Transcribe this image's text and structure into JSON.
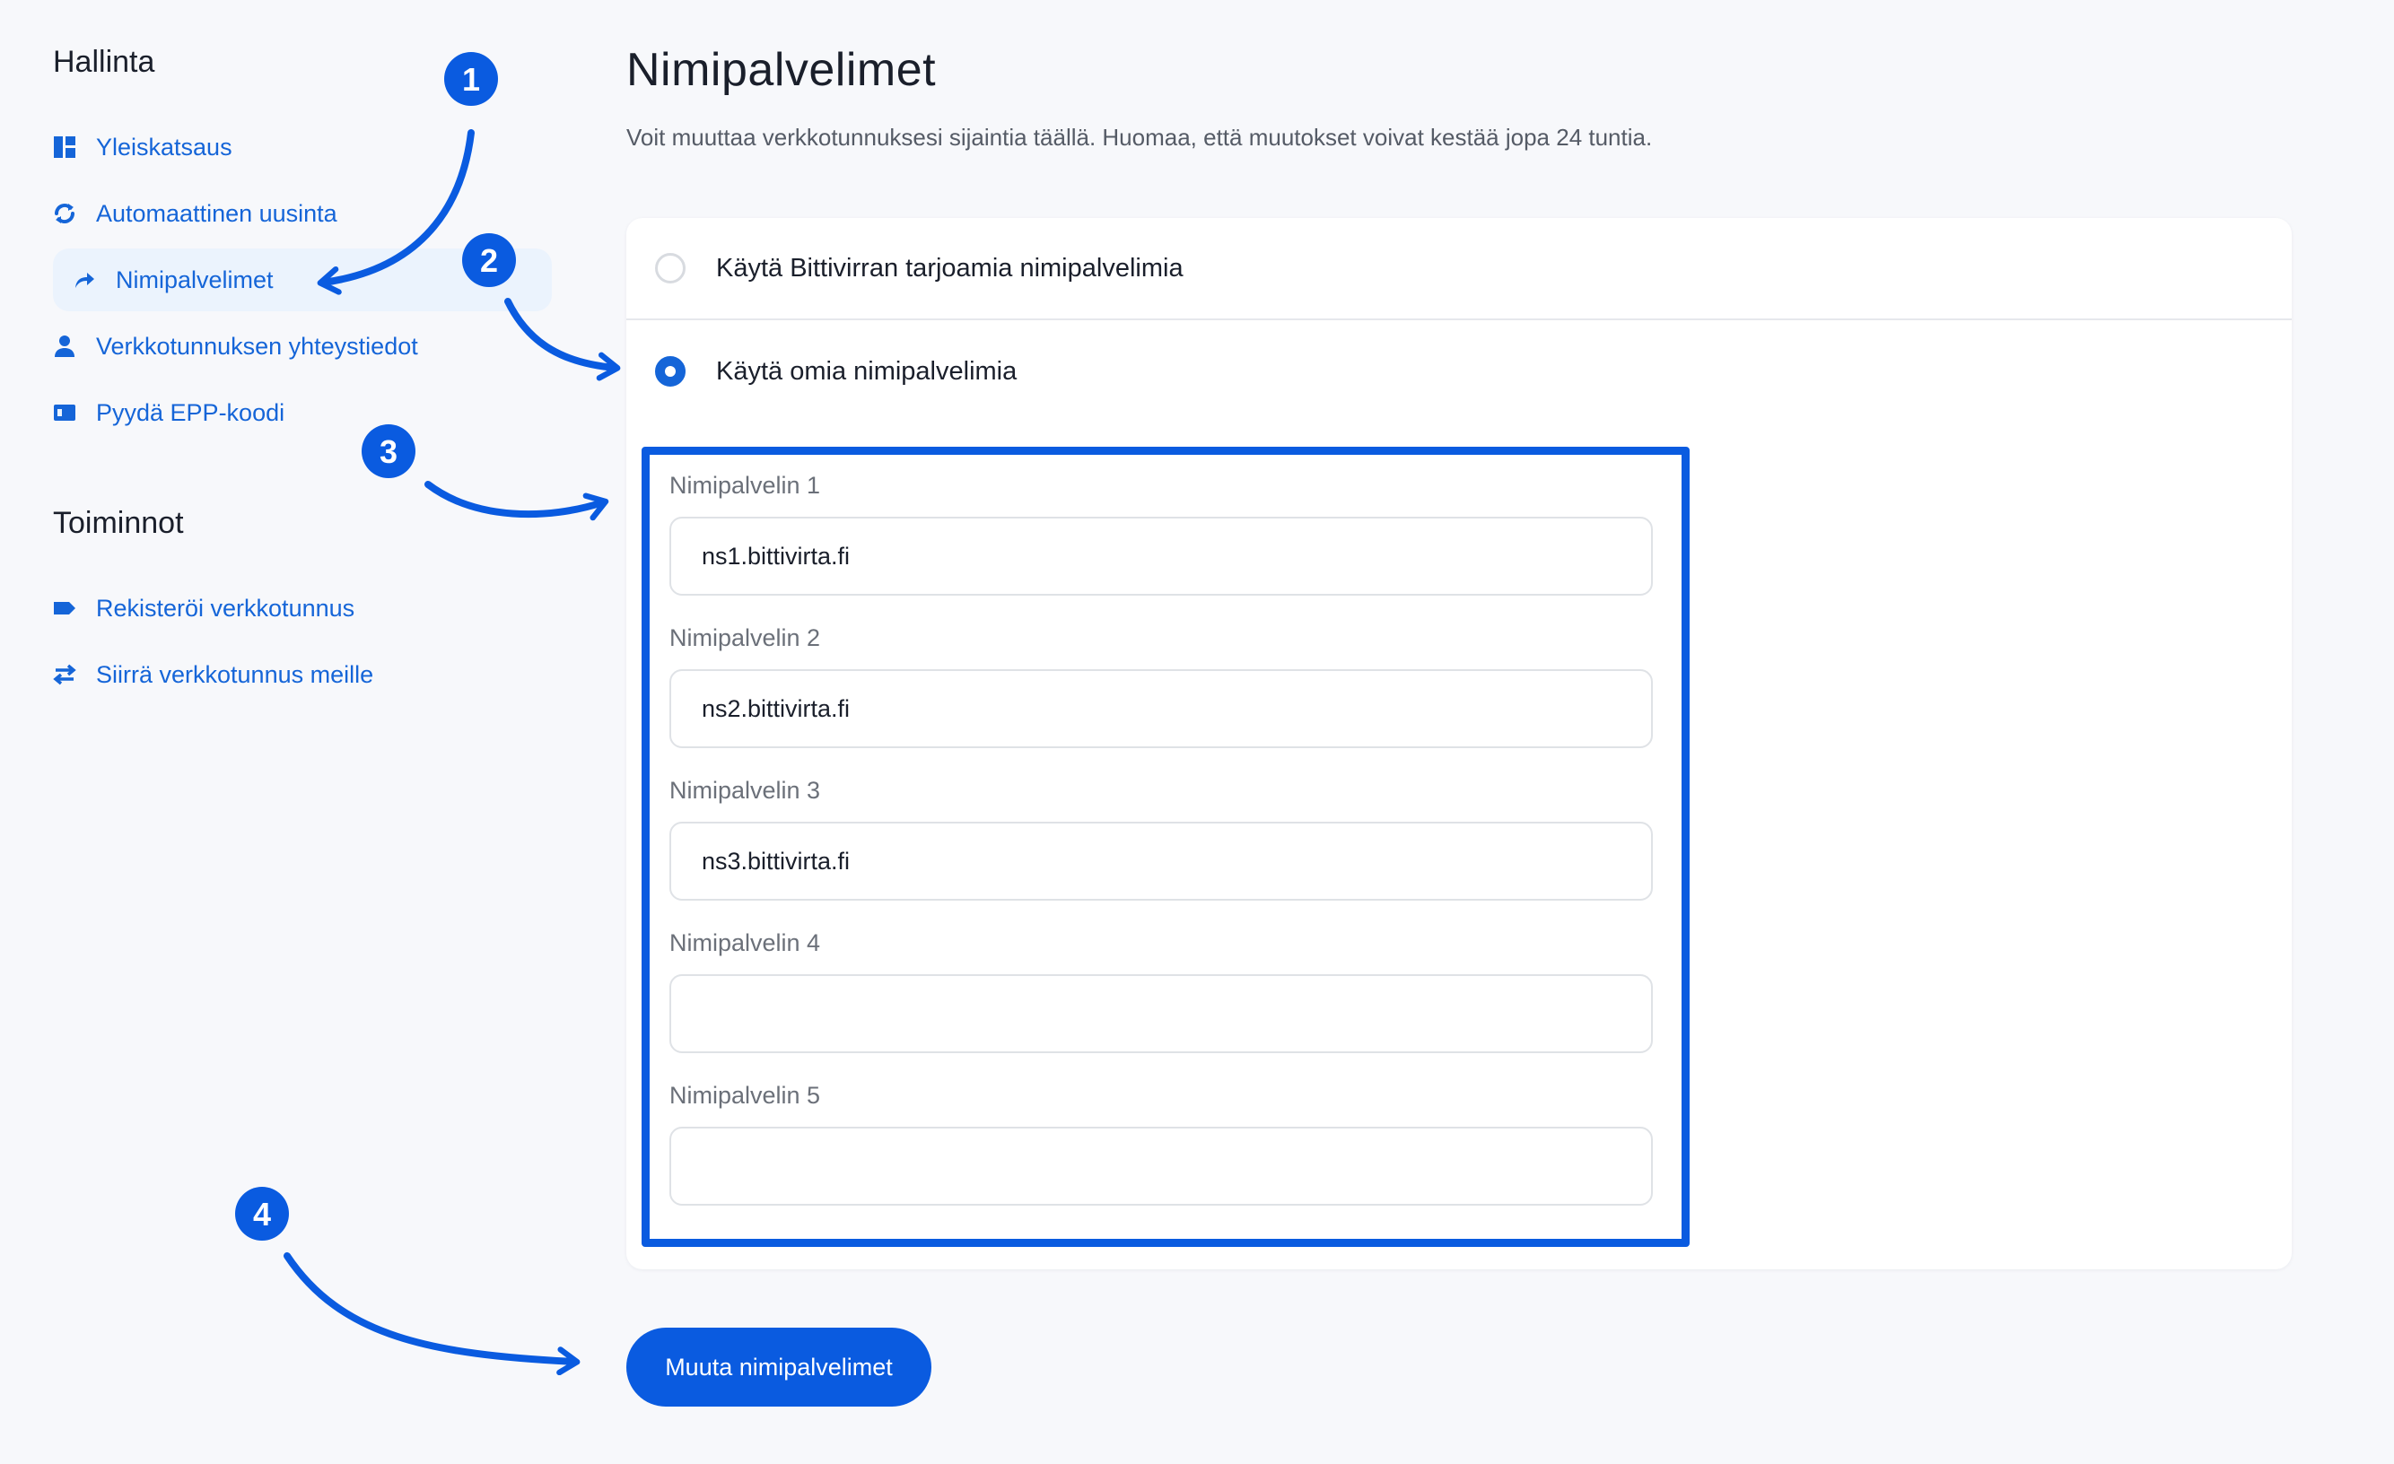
{
  "sidebar": {
    "section1_title": "Hallinta",
    "section2_title": "Toiminnot",
    "items": [
      {
        "label": "Yleiskatsaus",
        "icon": "dashboard-icon"
      },
      {
        "label": "Automaattinen uusinta",
        "icon": "sync-icon"
      },
      {
        "label": "Nimipalvelimet",
        "icon": "share-arrow-icon",
        "active": true
      },
      {
        "label": "Verkkotunnuksen yhteystiedot",
        "icon": "user-icon"
      },
      {
        "label": "Pyydä EPP-koodi",
        "icon": "id-card-icon"
      }
    ],
    "actions": [
      {
        "label": "Rekisteröi verkkotunnus",
        "icon": "tag-icon"
      },
      {
        "label": "Siirrä verkkotunnus meille",
        "icon": "transfer-arrows-icon"
      }
    ]
  },
  "main": {
    "title": "Nimipalvelimet",
    "description": "Voit muuttaa verkkotunnuksesi sijaintia täällä. Huomaa, että muutokset voivat kestää jopa 24 tuntia.",
    "options": [
      {
        "label": "Käytä Bittivirran tarjoamia nimipalvelimia",
        "checked": false
      },
      {
        "label": "Käytä omia nimipalvelimia",
        "checked": true
      }
    ],
    "nameservers": [
      {
        "label": "Nimipalvelin 1",
        "value": "ns1.bittivirta.fi"
      },
      {
        "label": "Nimipalvelin 2",
        "value": "ns2.bittivirta.fi"
      },
      {
        "label": "Nimipalvelin 3",
        "value": "ns3.bittivirta.fi"
      },
      {
        "label": "Nimipalvelin 4",
        "value": ""
      },
      {
        "label": "Nimipalvelin 5",
        "value": ""
      }
    ],
    "submit_label": "Muuta nimipalvelimet"
  },
  "annotations": {
    "badges": [
      "1",
      "2",
      "3",
      "4"
    ],
    "color": "#0a5be0"
  },
  "colors": {
    "accent": "#1565d8",
    "highlight": "#0a5be0",
    "background": "#f7f8fb"
  }
}
